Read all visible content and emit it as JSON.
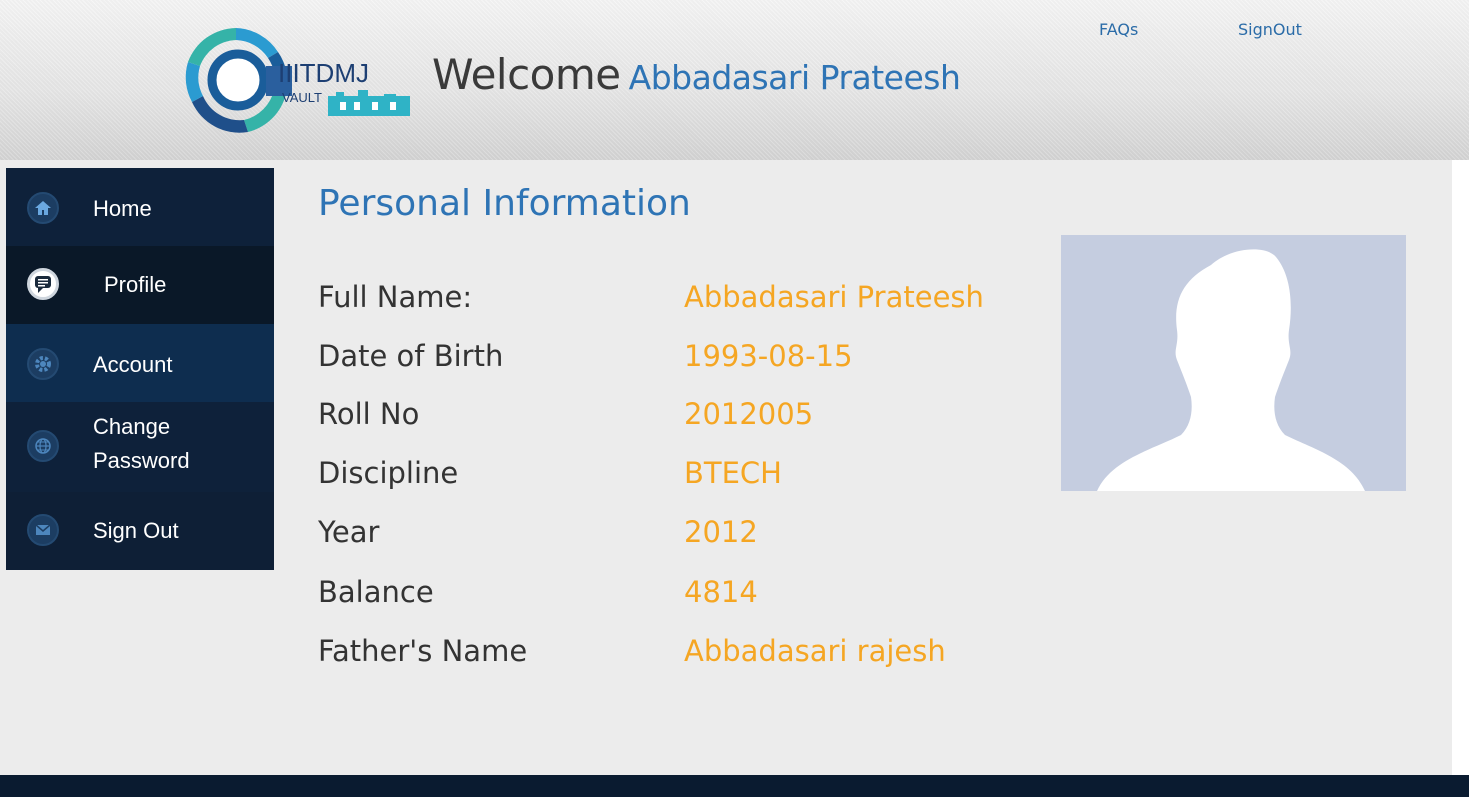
{
  "header": {
    "logo": {
      "text_main": "IIITDMJ",
      "text_sub": "VAULT"
    },
    "welcome_label": "Welcome",
    "user_name": "Abbadasari Prateesh",
    "links": [
      {
        "label": "FAQs"
      },
      {
        "label": "SignOut"
      }
    ]
  },
  "sidebar": {
    "items": [
      {
        "label": "Home",
        "icon": "home-icon"
      },
      {
        "label": "Profile",
        "icon": "chat-icon"
      },
      {
        "label": "Account",
        "icon": "gear-icon"
      },
      {
        "label": "Change",
        "label2": "Password",
        "icon": "globe-icon"
      },
      {
        "label": "Sign Out",
        "icon": "envelope-icon"
      }
    ]
  },
  "main": {
    "title": "Personal Information",
    "fields": [
      {
        "label": "Full Name:",
        "value": "Abbadasari Prateesh"
      },
      {
        "label": "Date of Birth",
        "value": "1993-08-15"
      },
      {
        "label": "Roll No",
        "value": "2012005"
      },
      {
        "label": "Discipline",
        "value": "BTECH"
      },
      {
        "label": "Year",
        "value": "2012"
      },
      {
        "label": "Balance",
        "value": "4814"
      },
      {
        "label": "Father's Name",
        "value": "Abbadasari rajesh"
      }
    ]
  },
  "colors": {
    "accent_blue": "#2e74b5",
    "value_orange": "#f5a623",
    "sidebar_bg": "#0d1f35",
    "footer_bg": "#0a1b30"
  }
}
